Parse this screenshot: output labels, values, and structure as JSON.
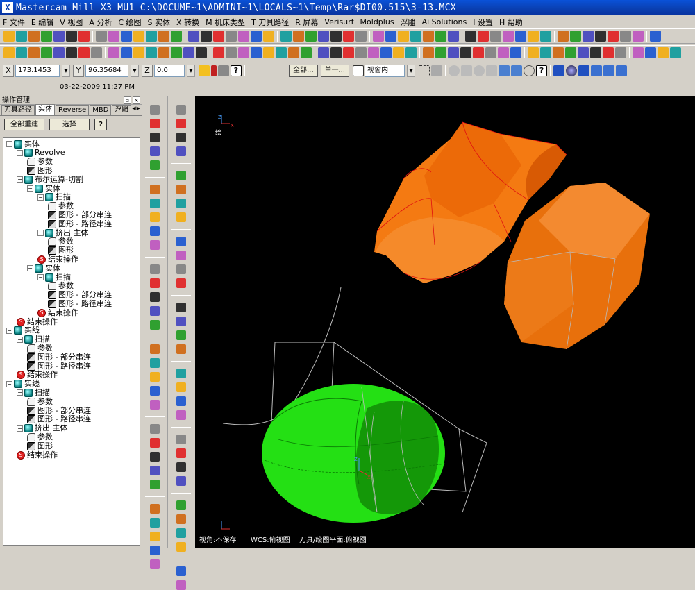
{
  "window": {
    "title": "Mastercam Mill X3 MU1  C:\\DOCUME~1\\ADMINI~1\\LOCALS~1\\Temp\\Rar$DI00.515\\3-13.MCX",
    "logo": "X"
  },
  "menu": [
    "F 文件",
    "E 编辑",
    "V 视图",
    "A 分析",
    "C 绘图",
    "S 实体",
    "X 转换",
    "M 机床类型",
    "T 刀具路径",
    "R 屏幕",
    "Verisurf",
    "Moldplus",
    "浮雕",
    "Ai Solutions",
    "I 设置",
    "H 帮助"
  ],
  "coords": {
    "x_label": "X",
    "x_value": "173.1453",
    "y_label": "Y",
    "y_value": "96.35684",
    "z_label": "Z",
    "z_value": "0.0",
    "btn_all": "全部...",
    "btn_single": "单一...",
    "view_select": "视窗内"
  },
  "datetime": "03-22-2009 11:27 PM",
  "panel": {
    "title": "操作管理",
    "tabs": [
      "刀具路径",
      "实体",
      "Reverse",
      "MBD",
      "浮雕"
    ],
    "active_tab": "实体",
    "btn_rebuild": "全部重建",
    "btn_select": "选择",
    "help": "?"
  },
  "tree": [
    {
      "label": "实体",
      "icon": "solid",
      "expander": "−"
    },
    {
      "label": "Revolve",
      "icon": "solid",
      "expander": "−"
    },
    {
      "label": "参数",
      "icon": "params"
    },
    {
      "label": "图形",
      "icon": "shape"
    },
    {
      "label": "布尔运算-切割",
      "icon": "solid",
      "expander": "−"
    },
    {
      "label": "实体",
      "icon": "solid",
      "expander": "−"
    },
    {
      "label": "扫描",
      "icon": "solid",
      "expander": "−"
    },
    {
      "label": "参数",
      "icon": "params"
    },
    {
      "label": "图形 - 部分串连",
      "icon": "shape"
    },
    {
      "label": "图形 - 路径串连",
      "icon": "shape"
    },
    {
      "label": "挤出 主体",
      "icon": "solid",
      "expander": "−"
    },
    {
      "label": "参数",
      "icon": "params"
    },
    {
      "label": "图形",
      "icon": "shape"
    },
    {
      "label": "结束操作",
      "icon": "end"
    },
    {
      "label": "实体",
      "icon": "solid",
      "expander": "−"
    },
    {
      "label": "扫描",
      "icon": "solid",
      "expander": "−"
    },
    {
      "label": "参数",
      "icon": "params"
    },
    {
      "label": "图形 - 部分串连",
      "icon": "shape"
    },
    {
      "label": "图形 - 路径串连",
      "icon": "shape"
    },
    {
      "label": "结束操作",
      "icon": "end"
    },
    {
      "label": "结束操作",
      "icon": "end"
    },
    {
      "label": "实线",
      "icon": "solid",
      "expander": "−"
    },
    {
      "label": "扫描",
      "icon": "solid",
      "expander": "−"
    },
    {
      "label": "参数",
      "icon": "params"
    },
    {
      "label": "图形 - 部分串连",
      "icon": "shape"
    },
    {
      "label": "图形 - 路径串连",
      "icon": "shape"
    },
    {
      "label": "结束操作",
      "icon": "end"
    },
    {
      "label": "实线",
      "icon": "solid",
      "expander": "−"
    },
    {
      "label": "扫描",
      "icon": "solid",
      "expander": "−"
    },
    {
      "label": "参数",
      "icon": "params"
    },
    {
      "label": "图形 - 部分串连",
      "icon": "shape"
    },
    {
      "label": "图形 - 路径串连",
      "icon": "shape"
    },
    {
      "label": "挤出 主体",
      "icon": "solid",
      "expander": "−"
    },
    {
      "label": "参数",
      "icon": "params"
    },
    {
      "label": "图形",
      "icon": "shape"
    },
    {
      "label": "结束操作",
      "icon": "end"
    }
  ],
  "viewport": {
    "status_view": "视角:不保存",
    "status_wcs": "WCS:俯视图",
    "status_plane": "刀具/绘图平面:俯视图",
    "axis_label": "绘",
    "colors": {
      "orange_solid": "#f07a10",
      "green_solid": "#22dd10",
      "background": "#000000"
    }
  }
}
